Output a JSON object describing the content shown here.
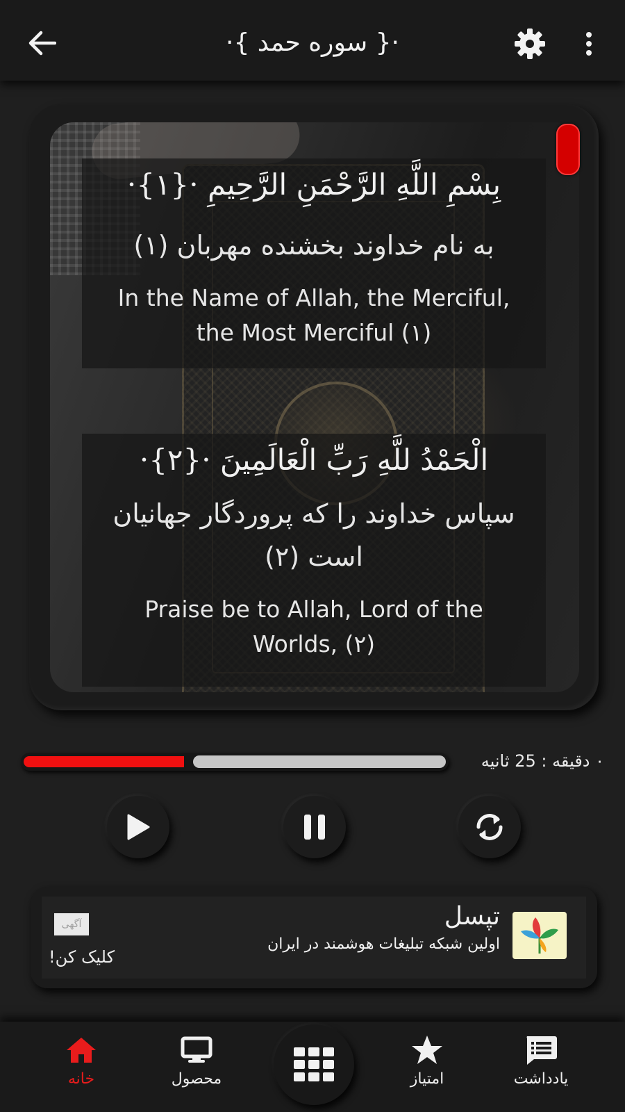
{
  "header": {
    "title": "·{ سوره حمد }·",
    "back_icon": "arrow-left-icon",
    "settings_icon": "gear-icon",
    "more_icon": "more-vertical-icon"
  },
  "verses": [
    {
      "arabic": "بِسْمِ اللَّهِ الرَّحْمَنِ الرَّحِيمِ ·{۱}·",
      "persian": "به نام خداوند بخشنده مهربان (۱)",
      "english": "In the Name of Allah, the Merciful, the Most Merciful (۱)"
    },
    {
      "arabic": "الْحَمْدُ للَّهِ رَبِّ الْعَالَمِينَ ·{۲}·",
      "persian": "سپاس خداوند را که پروردگار جهانیان است (۲)",
      "english": "Praise be to Allah, Lord of the Worlds, (۲)"
    }
  ],
  "player": {
    "time_label": "۰ دقیقه : 25 ثانیه",
    "progress_fraction": 0.38,
    "accent_color": "#f01010"
  },
  "ad": {
    "title": "تپسل",
    "subtitle": "اولین شبکه تبلیغات هوشمند در ایران",
    "badge": "آگهی",
    "cta": "کلیک کن!"
  },
  "nav": {
    "home": "خانه",
    "product": "محصول",
    "score": "امتیاز",
    "notes": "یادداشت"
  }
}
